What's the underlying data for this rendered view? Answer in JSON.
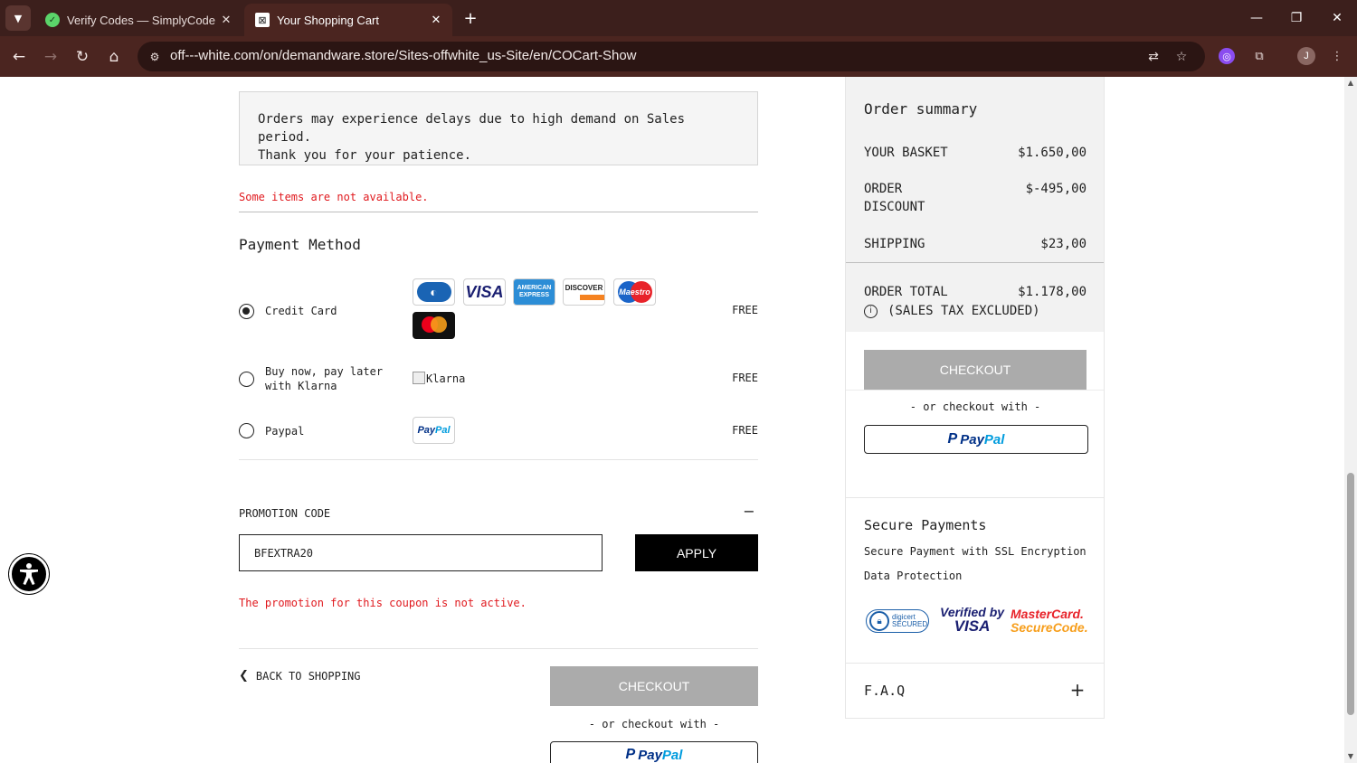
{
  "browser": {
    "tabs": [
      {
        "title": "Verify Codes — SimplyCodes",
        "active": false
      },
      {
        "title": "Your Shopping Cart",
        "active": true
      }
    ],
    "url": "off---white.com/on/demandware.store/Sites-offwhite_us-Site/en/COCart-Show",
    "profile_initial": "J"
  },
  "cart": {
    "notice_line1": "Orders may experience delays due to high demand on Sales period.",
    "notice_line2": "Thank you for your patience.",
    "availability_warning": "Some items are not available.",
    "payment_title": "Payment Method",
    "payment_methods": [
      {
        "label": "Credit Card",
        "price": "FREE",
        "selected": true
      },
      {
        "label_line1": "Buy now, pay later",
        "label_line2": "with Klarna",
        "price": "FREE",
        "selected": false,
        "logo_alt": "Klarna"
      },
      {
        "label": "Paypal",
        "price": "FREE",
        "selected": false
      }
    ],
    "card_logos": {
      "visa": "VISA",
      "amex_line1": "AMERICAN",
      "amex_line2": "EXPRESS",
      "discover": "DISCOVER",
      "maestro": "Maestro"
    },
    "paypal_logo": {
      "pay": "Pay",
      "pal": "Pal"
    },
    "promo": {
      "title": "PROMOTION CODE",
      "toggle": "−",
      "value": "BFEXTRA20",
      "apply_label": "APPLY",
      "error": "The promotion for this coupon is not active."
    },
    "back_label": "BACK TO SHOPPING",
    "checkout_label": "CHECKOUT",
    "or_checkout": "- or checkout with -"
  },
  "summary": {
    "title": "Order summary",
    "basket_label": "YOUR BASKET",
    "basket_value": "$1.650,00",
    "discount_label_line1": "ORDER",
    "discount_label_line2": "DISCOUNT",
    "discount_value": "$-495,00",
    "shipping_label": "SHIPPING",
    "shipping_value": "$23,00",
    "total_label": "ORDER TOTAL",
    "total_value": "$1.178,00",
    "tax_note": "(SALES TAX EXCLUDED)",
    "checkout_label": "CHECKOUT",
    "or_checkout": "- or checkout with -",
    "secure_title": "Secure Payments",
    "secure_line1": "Secure Payment with SSL Encryption",
    "secure_line2": "Data Protection",
    "badges": {
      "digicert_line1": "digicert",
      "digicert_line2": "SECURED",
      "vbv_line1": "Verified by",
      "vbv_line2": "VISA",
      "mc_line1": "MasterCard.",
      "mc_line2": "SecureCode."
    },
    "faq_label": "F.A.Q",
    "faq_toggle": "+"
  },
  "colors": {
    "chrome_dark": "#3c1f1c",
    "chrome_toolbar": "#4b2520",
    "error_red": "#e0191e",
    "checkout_disabled": "#ababab",
    "summary_bg": "#f2f2f2"
  }
}
